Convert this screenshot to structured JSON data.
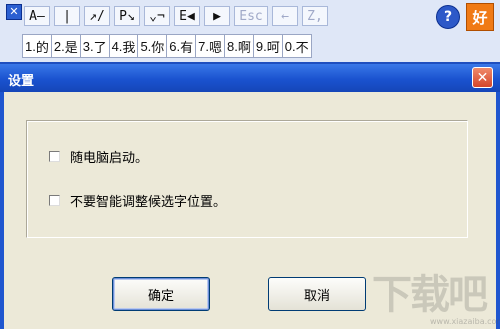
{
  "ime": {
    "close_glyph": "✕",
    "stroke_buttons": [
      {
        "label": "A—",
        "dim": false
      },
      {
        "label": "|",
        "dim": false
      },
      {
        "label": "↗/",
        "dim": false
      },
      {
        "label": "P↘",
        "dim": false
      },
      {
        "label": "⌄¬",
        "dim": false
      },
      {
        "label": "E◀",
        "dim": false
      },
      {
        "label": "▶",
        "dim": false
      },
      {
        "label": "Esc",
        "dim": true
      },
      {
        "label": "←",
        "dim": true
      },
      {
        "label": "Z,",
        "dim": true
      }
    ],
    "help_label": "?",
    "good_label": "好",
    "candidates": [
      {
        "num": "1.",
        "char": "的"
      },
      {
        "num": "2.",
        "char": "是"
      },
      {
        "num": "3.",
        "char": "了"
      },
      {
        "num": "4.",
        "char": "我"
      },
      {
        "num": "5.",
        "char": "你"
      },
      {
        "num": "6.",
        "char": "有"
      },
      {
        "num": "7.",
        "char": "嗯"
      },
      {
        "num": "8.",
        "char": "啊"
      },
      {
        "num": "9.",
        "char": "呵"
      },
      {
        "num": "0.",
        "char": "不"
      }
    ]
  },
  "dialog": {
    "title": "设置",
    "close_glyph": "✕",
    "options": [
      {
        "label": "随电脑启动。",
        "checked": false
      },
      {
        "label": "不要智能调整候选字位置。",
        "checked": false
      }
    ],
    "ok_label": "确定",
    "cancel_label": "取消"
  },
  "watermark": {
    "logo_text": "下载吧",
    "url": "www.xiazaiba.com"
  }
}
